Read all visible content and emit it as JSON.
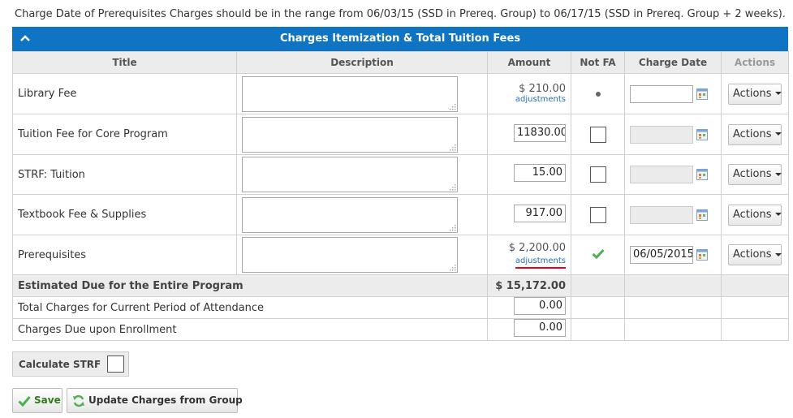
{
  "notice": "Charge Date of Prerequisites Charges should be in the range from 06/03/15 (SSD in Prereq. Group) to 06/17/15 (SSD in Prereq. Group + 2 weeks).",
  "panel": {
    "title": "Charges Itemization & Total Tuition Fees",
    "collapse_icon": "chevron-up-icon"
  },
  "columns": {
    "title": "Title",
    "description": "Description",
    "amount": "Amount",
    "not_fa": "Not FA",
    "charge_date": "Charge Date",
    "actions": "Actions"
  },
  "rows": [
    {
      "title": "Library Fee",
      "amount": "$ 210.00",
      "adjustments": "adjustments",
      "not_fa": "dot",
      "charge_date": "",
      "actions": "Actions"
    },
    {
      "title": "Tuition Fee for Core Program",
      "amount": "11830.00",
      "not_fa": "unchecked",
      "charge_date": "",
      "actions": "Actions"
    },
    {
      "title": "STRF: Tuition",
      "amount": "15.00",
      "not_fa": "unchecked",
      "charge_date": "",
      "actions": "Actions"
    },
    {
      "title": "Textbook Fee & Supplies",
      "amount": "917.00",
      "not_fa": "unchecked",
      "charge_date": "",
      "actions": "Actions"
    },
    {
      "title": "Prerequisites",
      "amount": "$ 2,200.00",
      "adjustments": "adjustments",
      "not_fa": "checked",
      "charge_date": "06/05/2015",
      "actions": "Actions"
    }
  ],
  "totals": {
    "estimated_label": "Estimated Due for the Entire Program",
    "estimated_value": "$ 15,172.00",
    "current_period_label": "Total Charges for Current Period of Attendance",
    "current_period_value": "0.00",
    "enrollment_label": "Charges Due upon Enrollment",
    "enrollment_value": "0.00"
  },
  "calculate_strf": {
    "label": "Calculate STRF",
    "checked": false
  },
  "buttons": {
    "save": "Save",
    "update": "Update Charges from Group"
  },
  "colors": {
    "header_blue": "#0f74c4",
    "link_blue": "#2a6ebb",
    "highlight_red": "#e8001c",
    "check_green": "#4caf50"
  }
}
